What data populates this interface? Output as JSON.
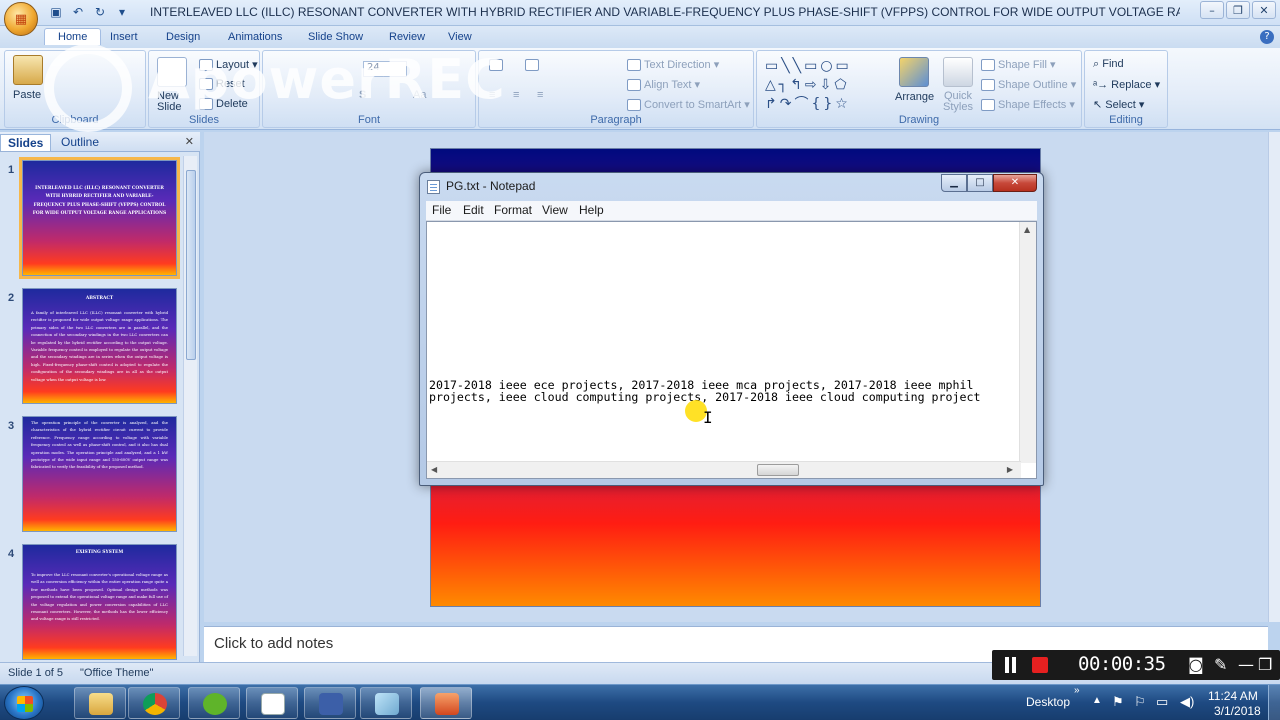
{
  "window": {
    "title": "INTERLEAVED LLC (ILLC) RESONANT CONVERTER WITH HYBRID RECTIFIER AND VARIABLE-FREQUENCY PLUS PHASE-SHIFT (VFPPS) CONTROL FOR WIDE OUTPUT VOLTAGE RANGE APPLICATIONS.pptx - M..."
  },
  "ribbon": {
    "tabs": [
      "Home",
      "Insert",
      "Design",
      "Animations",
      "Slide Show",
      "Review",
      "View"
    ],
    "groups": {
      "clipboard": {
        "label": "Clipboard",
        "paste": "Paste"
      },
      "slides": {
        "label": "Slides",
        "new_slide": "New Slide",
        "layout": "Layout",
        "reset": "Reset",
        "delete": "Delete"
      },
      "font": {
        "label": "Font",
        "size": "24"
      },
      "paragraph": {
        "label": "Paragraph",
        "text_direction": "Text Direction",
        "align_text": "Align Text",
        "smartart": "Convert to SmartArt"
      },
      "drawing": {
        "label": "Drawing",
        "arrange": "Arrange",
        "quick_styles": "Quick Styles",
        "shape_fill": "Shape Fill",
        "shape_outline": "Shape Outline",
        "shape_effects": "Shape Effects"
      },
      "editing": {
        "label": "Editing",
        "find": "Find",
        "replace": "Replace",
        "select": "Select"
      }
    }
  },
  "watermark": "ApowerREC",
  "slides_panel": {
    "tabs": [
      "Slides",
      "Outline"
    ],
    "thumbnails": [
      {
        "num": "1",
        "title": "INTERLEAVED LLC (ILLC) RESONANT CONVERTER WITH HYBRID RECTIFIER AND VARIABLE-FREQUENCY PLUS PHASE-SHIFT (VFPPS) CONTROL FOR WIDE OUTPUT VOLTAGE RANGE APPLICATIONS",
        "body": ""
      },
      {
        "num": "2",
        "title": "ABSTRACT",
        "body": "A family of interleaved LLC (ILLC) resonant converter with hybrid rectifier is proposed for wide output voltage range applications. The primary sides of the two LLC converters are in parallel, and the connection of the secondary windings in the two LLC converters can be regulated by the hybrid rectifier according to the output voltage. Variable frequency control is employed to regulate the output voltage and the secondary windings are in series when the output voltage is high. Fixed-frequency phase-shift control is adopted to regulate the configuration of the secondary windings are in all as the output voltage when the output voltage is low."
      },
      {
        "num": "3",
        "title": "",
        "body": "The operation principle of the converter is analyzed, and the characteristics of the hybrid rectifier circuit current to provide reference. Frequency range according to voltage with variable frequency control as well as phase-shift control, and it also has dual operation modes. The operation principle and analyzed, and a 1 kW prototype of the wide input range and 150-600V output range was fabricated to verify the feasibility of the proposed method."
      },
      {
        "num": "4",
        "title": "EXISTING SYSTEM",
        "body": "To improve the LLC resonant converter's operational voltage range as well as conversion efficiency within the entire operation range quite a few methods have been proposed. Optimal design methods was proposed to extend the operational voltage range and make full use of the voltage regulation and power conversion capabilities of LLC resonant converters. However, the methods has the lower efficiency and voltage range is still restricted."
      }
    ]
  },
  "notepad": {
    "title": "PG.txt - Notepad",
    "menu": [
      "File",
      "Edit",
      "Format",
      "View",
      "Help"
    ],
    "content": "2017-2018 ieee ece projects, 2017-2018 ieee mca projects, 2017-2018 ieee mphil\nprojects, ieee cloud computing projects, 2017-2018 ieee cloud computing project"
  },
  "notes_placeholder": "Click to add notes",
  "statusbar": {
    "slide_info": "Slide 1 of 5",
    "theme": "\"Office Theme\""
  },
  "recorder": {
    "time": "00:00:35"
  },
  "taskbar": {
    "desktop_label": "Desktop",
    "time": "11:24 AM",
    "date": "3/1/2018"
  },
  "colors": {
    "accent": "#15428b",
    "record_red": "#e52020"
  }
}
